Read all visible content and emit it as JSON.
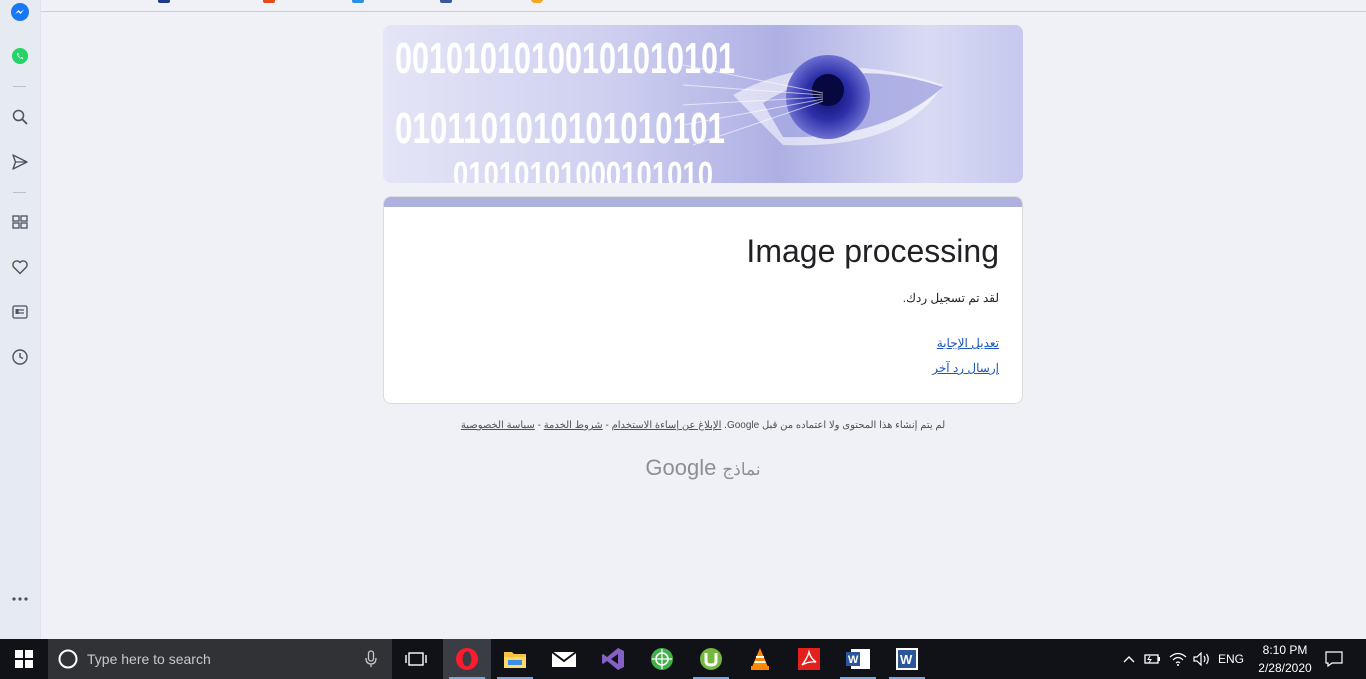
{
  "sidebar": {
    "items": [
      {
        "name": "messenger-icon"
      },
      {
        "name": "whatsapp-icon"
      },
      {
        "name": "search-icon"
      },
      {
        "name": "send-icon"
      },
      {
        "name": "speed-dial-icon"
      },
      {
        "name": "heart-icon"
      },
      {
        "name": "news-icon"
      },
      {
        "name": "history-icon"
      },
      {
        "name": "more-icon"
      }
    ]
  },
  "form": {
    "title": "Image processing",
    "confirmation": "لقد تم تسجيل ردك.",
    "edit_link": "تعديل الإجابة",
    "another_link": "إرسال رد آخر",
    "banner_digits": [
      "00101010100101010101",
      "0101101010101010101",
      "01010101000101010"
    ]
  },
  "footer": {
    "notice": "لم يتم إنشاء هذا المحتوى ولا اعتماده من قبل Google.",
    "report_link": "الإبلاغ عن إساءة الاستخدام",
    "sep1": " - ",
    "terms_link": "شروط الخدمة",
    "sep2": " - ",
    "privacy_link": "سياسة الخصوصية",
    "logo_google": "Google",
    "logo_forms": "نماذج"
  },
  "taskbar": {
    "search_placeholder": "Type here to search",
    "apps": [
      "task-view-icon",
      "opera-icon",
      "file-explorer-icon",
      "mail-icon",
      "visual-studio-icon",
      "anaconda-icon",
      "utorrent-icon",
      "vlc-icon",
      "acrobat-icon",
      "word-icon",
      "word-doc-icon"
    ],
    "language": "ENG",
    "time": "8:10 PM",
    "date": "2/28/2020"
  },
  "colors": {
    "link": "#1a55c4",
    "card_accent": "#aeb0dd",
    "eye": "#2d2fa8"
  }
}
